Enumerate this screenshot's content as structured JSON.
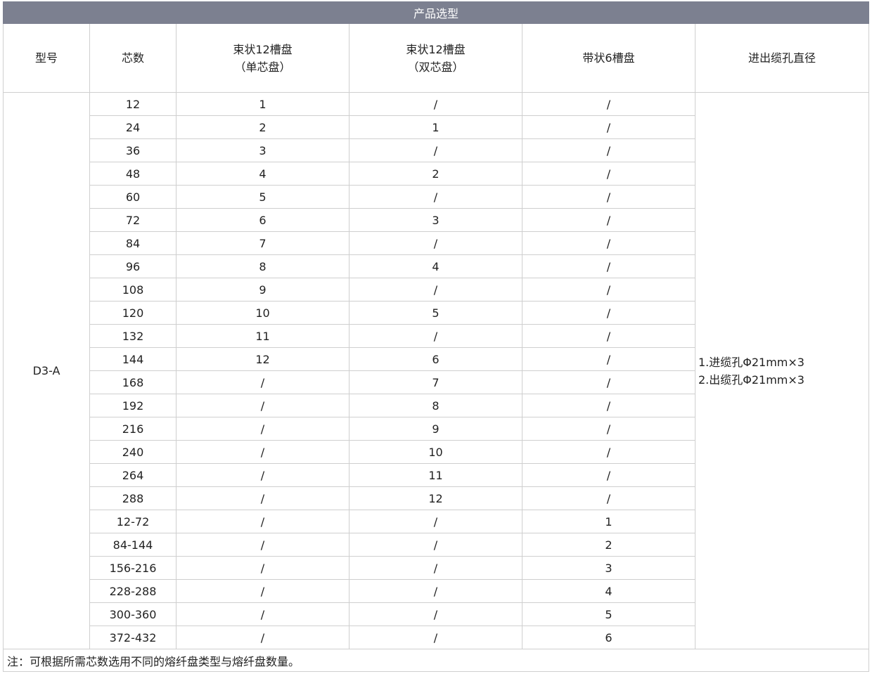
{
  "title": "产品选型",
  "headers": {
    "model": "型号",
    "cores": "芯数",
    "bundle_single_l1": "束状12槽盘",
    "bundle_single_l2": "（单芯盘）",
    "bundle_double_l1": "束状12槽盘",
    "bundle_double_l2": "（双芯盘）",
    "ribbon": "带状6槽盘",
    "hole": "进出缆孔直径"
  },
  "model": "D3-A",
  "hole_specs": [
    "1.进缆孔Φ21mm×3",
    "2.出缆孔Φ21mm×3"
  ],
  "rows": [
    [
      "12",
      "1",
      "/",
      "/"
    ],
    [
      "24",
      "2",
      "1",
      "/"
    ],
    [
      "36",
      "3",
      "/",
      "/"
    ],
    [
      "48",
      "4",
      "2",
      "/"
    ],
    [
      "60",
      "5",
      "/",
      "/"
    ],
    [
      "72",
      "6",
      "3",
      "/"
    ],
    [
      "84",
      "7",
      "/",
      "/"
    ],
    [
      "96",
      "8",
      "4",
      "/"
    ],
    [
      "108",
      "9",
      "/",
      "/"
    ],
    [
      "120",
      "10",
      "5",
      "/"
    ],
    [
      "132",
      "11",
      "/",
      "/"
    ],
    [
      "144",
      "12",
      "6",
      "/"
    ],
    [
      "168",
      "/",
      "7",
      "/"
    ],
    [
      "192",
      "/",
      "8",
      "/"
    ],
    [
      "216",
      "/",
      "9",
      "/"
    ],
    [
      "240",
      "/",
      "10",
      "/"
    ],
    [
      "264",
      "/",
      "11",
      "/"
    ],
    [
      "288",
      "/",
      "12",
      "/"
    ],
    [
      "12-72",
      "/",
      "/",
      "1"
    ],
    [
      "84-144",
      "/",
      "/",
      "2"
    ],
    [
      "156-216",
      "/",
      "/",
      "3"
    ],
    [
      "228-288",
      "/",
      "/",
      "4"
    ],
    [
      "300-360",
      "/",
      "/",
      "5"
    ],
    [
      "372-432",
      "/",
      "/",
      "6"
    ]
  ],
  "note": "注：可根据所需芯数选用不同的熔纤盘类型与熔纤盘数量。"
}
